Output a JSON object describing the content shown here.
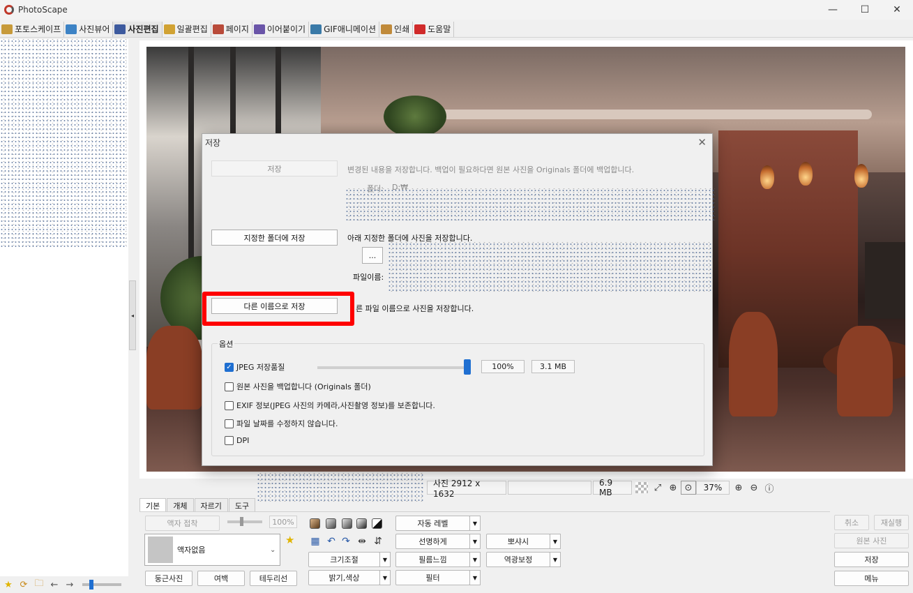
{
  "window": {
    "title": "PhotoScape",
    "minimize": "—",
    "maximize": "☐",
    "close": "✕"
  },
  "main_tabs": [
    {
      "label": "포토스케이프",
      "color": "#c79a3a"
    },
    {
      "label": "사진뷰어",
      "color": "#3d83c5"
    },
    {
      "label": "사진편집",
      "color": "#3d5a9e",
      "active": true
    },
    {
      "label": "일괄편집",
      "color": "#d1a233"
    },
    {
      "label": "페이지",
      "color": "#b94b3a"
    },
    {
      "label": "이어붙이기",
      "color": "#6a55a8"
    },
    {
      "label": "GIF애니메이션",
      "color": "#3a7aa8"
    },
    {
      "label": "인쇄",
      "color": "#c08a3a"
    },
    {
      "label": "도움말",
      "color": "#d02a2a"
    }
  ],
  "splitter_arrow": "◂",
  "status": {
    "photo_size": "사진 2912 x 1632",
    "file_size": "6.9 MB",
    "zoom": "37%"
  },
  "tool_tabs": [
    "기본",
    "개체",
    "자르기",
    "도구"
  ],
  "basic_panel": {
    "frame_attach": "액자 접착",
    "frame_percent": "100%",
    "frame_name": "액자없음",
    "round_photo": "둥근사진",
    "margin": "여백",
    "border": "테두리선",
    "resize": "크기조절",
    "brightness": "밝기,색상",
    "auto_level": "자동 레벨",
    "sharpen": "선명하게",
    "film_effect": "필름느낌",
    "filter": "필터",
    "sharpen2": "뽀샤시",
    "backlight": "역광보정"
  },
  "right_buttons": {
    "cancel": "취소",
    "redo": "재실행",
    "original": "원본 사진",
    "save": "저장",
    "menu": "메뉴"
  },
  "dialog": {
    "title": "저장",
    "close": "✕",
    "save_button": "저장",
    "save_desc": "변경된 내용을 저장합니다. 백업이 필요하다면 원본 사진을 Originals 폴더에 백업합니다.",
    "folder_label": "폴더:",
    "folder_value": "D:₩",
    "save_to_folder_button": "지정한 폴더에 저장",
    "save_to_folder_desc": "아래 지정한 폴더에 사진을 저장합니다.",
    "browse_button": "...",
    "filename_label": "파일이름:",
    "save_as_button": "다른 이름으로 저장",
    "save_as_desc": "른 파일 이름으로 사진을 저장합니다.",
    "options_title": "옵션",
    "jpeg_quality_label": "JPEG 저장품질",
    "jpeg_quality_value": "100%",
    "jpeg_size_value": "3.1 MB",
    "backup_label": "원본 사진을 백업합니다 (Originals 폴더)",
    "exif_label": "EXIF 정보(JPEG 사진의 카메라,사진촬영 정보)를 보존합니다.",
    "keep_date_label": "파일 날짜를 수정하지 않습니다.",
    "dpi_label": "DPI",
    "jpeg_quality_checked": true,
    "jpeg_quality_fraction": 1.0
  },
  "colors": {
    "accent": "#1f6fd1",
    "highlight": "#ff0000"
  }
}
